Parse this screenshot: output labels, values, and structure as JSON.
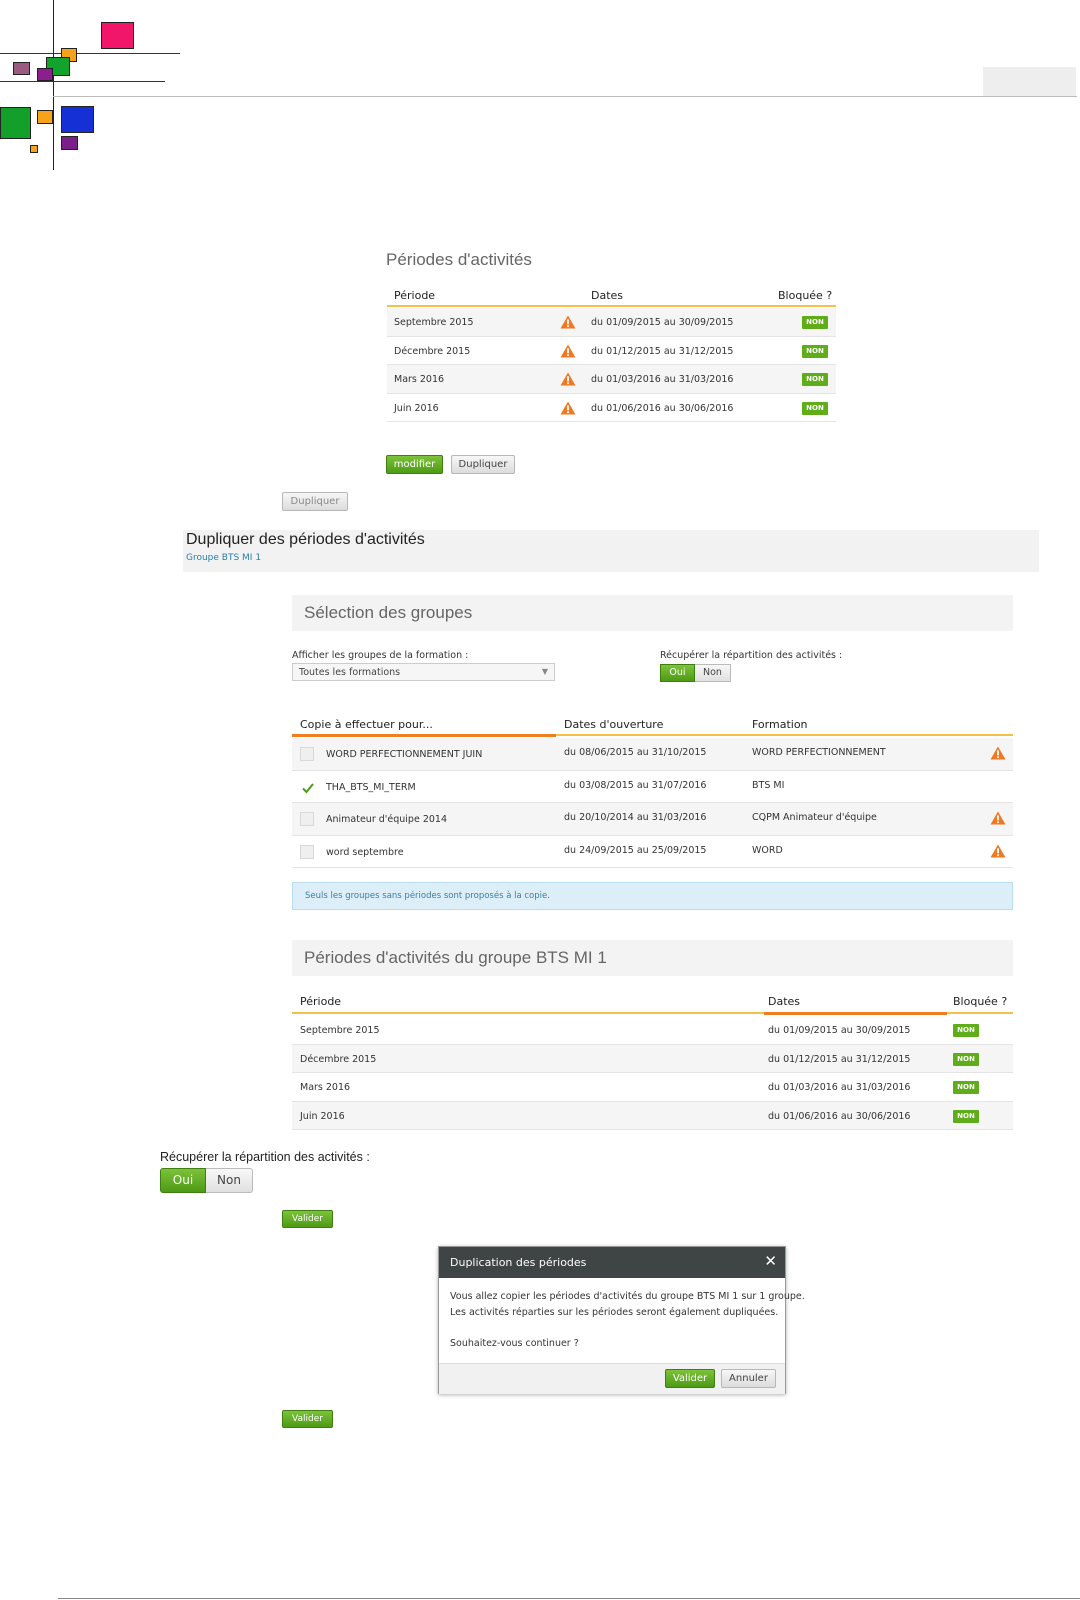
{
  "colors": {
    "accent_green": "#5fae19",
    "underline_orange": "#f0a030",
    "warn_orange": "#f07820",
    "dialog_header": "#3f4444",
    "info_blue": "#dceef8"
  },
  "periods_panel": {
    "title": "Périodes d'activités",
    "headers": {
      "periode": "Période",
      "dates": "Dates",
      "bloquee": "Bloquée ?"
    },
    "rows": [
      {
        "periode": "Septembre 2015",
        "dates": "du 01/09/2015 au 30/09/2015",
        "bloquee": "NON",
        "icon": "warning-icon"
      },
      {
        "periode": "Décembre 2015",
        "dates": "du 01/12/2015 au 31/12/2015",
        "bloquee": "NON",
        "icon": "warning-icon"
      },
      {
        "periode": "Mars 2016",
        "dates": "du 01/03/2016 au 31/03/2016",
        "bloquee": "NON",
        "icon": "warning-icon"
      },
      {
        "periode": "Juin 2016",
        "dates": "du 01/06/2016 au 30/06/2016",
        "bloquee": "NON",
        "icon": "warning-icon"
      }
    ],
    "modify_label": "modifier",
    "duplicate_label": "Dupliquer"
  },
  "standalone_duplicate_label": "Dupliquer",
  "dup_header": {
    "title": "Dupliquer des périodes d'activités",
    "subtitle": "Groupe BTS MI 1"
  },
  "selection": {
    "title": "Sélection des groupes",
    "filter_label": "Afficher les groupes de la formation :",
    "filter_value": "Toutes les formations",
    "recup_label": "Récupérer la répartition des activités :",
    "yes": "Oui",
    "no": "Non",
    "headers": {
      "copie": "Copie à effectuer pour...",
      "dates": "Dates d'ouverture",
      "formation": "Formation"
    },
    "rows": [
      {
        "name": "WORD PERFECTIONNEMENT JUIN",
        "dates": "du 08/06/2015 au 31/10/2015",
        "formation": "WORD PERFECTIONNEMENT",
        "checked": false,
        "warn": true
      },
      {
        "name": "THA_BTS_MI_TERM",
        "dates": "du 03/08/2015 au 31/07/2016",
        "formation": "BTS MI",
        "checked": true,
        "warn": false
      },
      {
        "name": "Animateur d'équipe 2014",
        "dates": "du 20/10/2014 au 31/03/2016",
        "formation": "CQPM Animateur d'équipe",
        "checked": false,
        "warn": true
      },
      {
        "name": "word septembre",
        "dates": "du 24/09/2015 au 25/09/2015",
        "formation": "WORD",
        "checked": false,
        "warn": true
      }
    ],
    "info": "Seuls les groupes sans périodes sont proposés à la copie."
  },
  "group_periods": {
    "title": "Périodes d'activités du groupe BTS MI 1",
    "headers": {
      "periode": "Période",
      "dates": "Dates",
      "bloquee": "Bloquée ?"
    },
    "rows": [
      {
        "periode": "Septembre 2015",
        "dates": "du 01/09/2015 au 30/09/2015",
        "bloquee": "NON"
      },
      {
        "periode": "Décembre 2015",
        "dates": "du 01/12/2015 au 31/12/2015",
        "bloquee": "NON"
      },
      {
        "periode": "Mars 2016",
        "dates": "du 01/03/2016 au 31/03/2016",
        "bloquee": "NON"
      },
      {
        "periode": "Juin 2016",
        "dates": "du 01/06/2016 au 30/06/2016",
        "bloquee": "NON"
      }
    ]
  },
  "large_recup": {
    "label": "Récupérer la répartition des activités :",
    "yes": "Oui",
    "no": "Non"
  },
  "valider_label": "Valider",
  "dialog": {
    "title": "Duplication des périodes",
    "close": "✕",
    "line1_pre": "Vous allez copier les périodes d'activités du ",
    "line1_group": "groupe BTS MI 1",
    "line1_mid": " sur ",
    "line1_count": "1 groupe",
    "line1_post": ".",
    "line2": "Les activités réparties sur les périodes seront également dupliquées.",
    "question": "Souhaitez-vous continuer ?",
    "ok": "Valider",
    "cancel": "Annuler"
  },
  "valider_label_2": "Valider"
}
